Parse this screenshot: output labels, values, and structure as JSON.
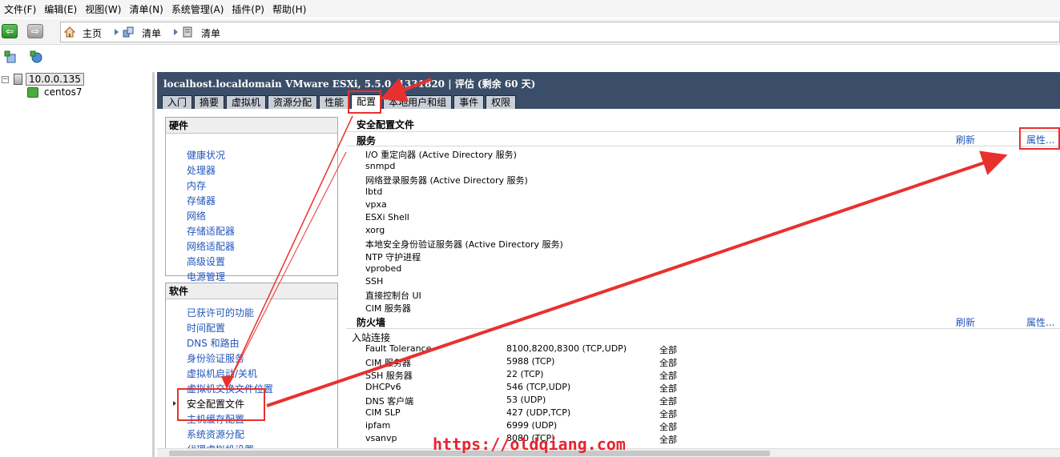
{
  "menu": [
    "文件(F)",
    "编辑(E)",
    "视图(W)",
    "清单(N)",
    "系统管理(A)",
    "插件(P)",
    "帮助(H)"
  ],
  "breadcrumb": {
    "home": "主页",
    "inventory1": "清单",
    "inventory2": "清单"
  },
  "tree": {
    "host": "10.0.0.135",
    "vm": "centos7"
  },
  "header": {
    "title": "localhost.localdomain VMware ESXi, 5.5.0, 1331820 | 评估 (剩余 60 天)",
    "tabs": [
      "入门",
      "摘要",
      "虚拟机",
      "资源分配",
      "性能",
      "配置",
      "本地用户和组",
      "事件",
      "权限"
    ],
    "active_tab": "配置"
  },
  "hardware": {
    "title": "硬件",
    "items": [
      "健康状况",
      "处理器",
      "内存",
      "存储器",
      "网络",
      "存储适配器",
      "网络适配器",
      "高级设置",
      "电源管理"
    ]
  },
  "software": {
    "title": "软件",
    "items": [
      "已获许可的功能",
      "时间配置",
      "DNS 和路由",
      "身份验证服务",
      "虚拟机启动/关机",
      "虚拟机交换文件位置",
      "安全配置文件",
      "主机缓存配置",
      "系统资源分配",
      "代理虚拟机设置"
    ],
    "selected": "安全配置文件"
  },
  "main": {
    "title": "安全配置文件",
    "services": {
      "title": "服务",
      "refresh": "刷新",
      "properties": "属性...",
      "items": [
        "I/O 重定向器 (Active Directory 服务)",
        "snmpd",
        "网络登录服务器 (Active Directory 服务)",
        "lbtd",
        "vpxa",
        "ESXi Shell",
        "xorg",
        "本地安全身份验证服务器 (Active Directory 服务)",
        "NTP 守护进程",
        "vprobed",
        "SSH",
        "直接控制台 UI",
        "CIM 服务器"
      ]
    },
    "firewall": {
      "title": "防火墙",
      "refresh": "刷新",
      "properties": "属性...",
      "inbound": "入站连接",
      "rows": [
        {
          "name": "Fault Tolerance",
          "ports": "8100,8200,8300 (TCP,UDP)",
          "scope": "全部"
        },
        {
          "name": "CIM 服务器",
          "ports": "5988 (TCP)",
          "scope": "全部"
        },
        {
          "name": "SSH 服务器",
          "ports": "22 (TCP)",
          "scope": "全部"
        },
        {
          "name": "DHCPv6",
          "ports": "546 (TCP,UDP)",
          "scope": "全部"
        },
        {
          "name": "DNS 客户端",
          "ports": "53 (UDP)",
          "scope": "全部"
        },
        {
          "name": "CIM SLP",
          "ports": "427 (UDP,TCP)",
          "scope": "全部"
        },
        {
          "name": "ipfam",
          "ports": "6999 (UDP)",
          "scope": "全部"
        },
        {
          "name": "vsanvp",
          "ports": "8080 (TCP)",
          "scope": "全部"
        }
      ]
    }
  },
  "watermark": "https://oldqiang.com",
  "annotation_color": "#e8312f"
}
